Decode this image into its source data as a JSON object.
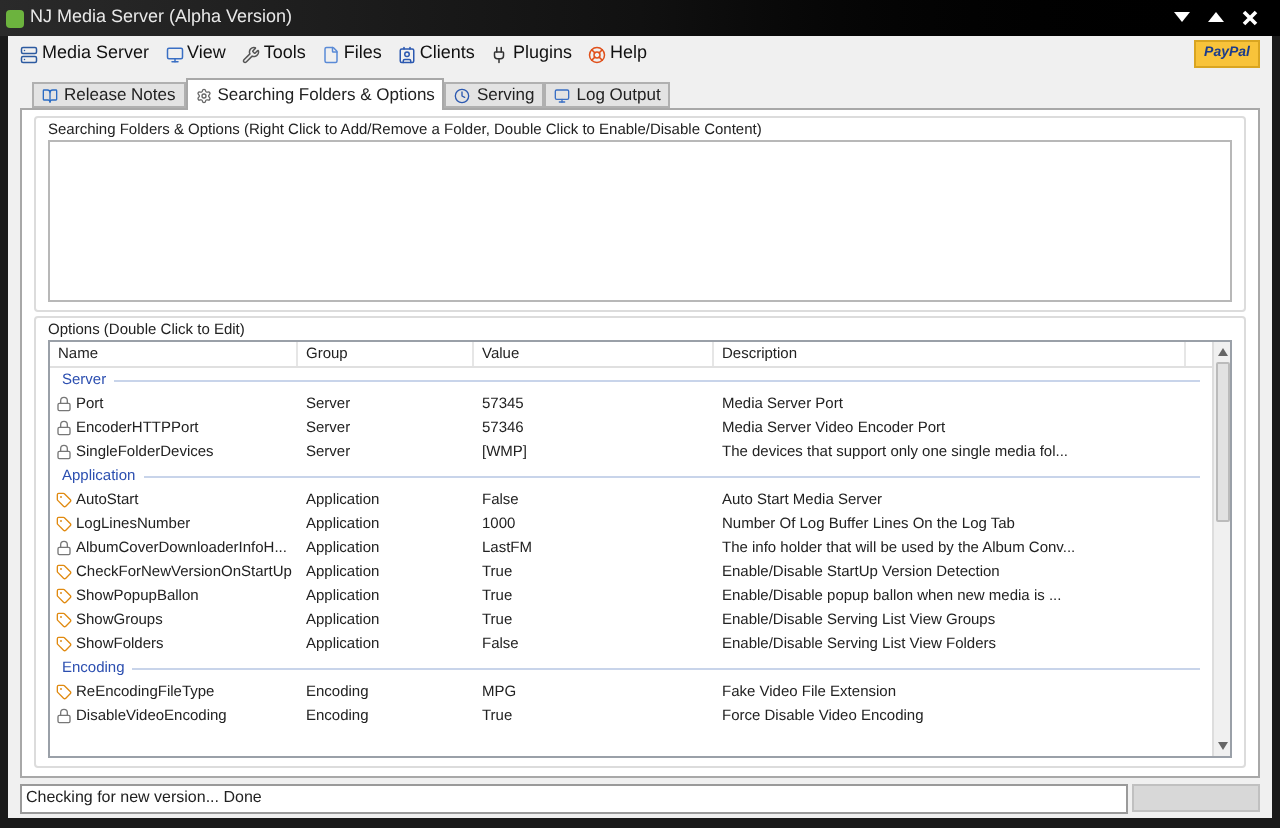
{
  "window": {
    "title": "NJ Media Server (Alpha Version)"
  },
  "menu": [
    {
      "label": "Media Server",
      "kind": "server"
    },
    {
      "label": "View",
      "kind": "monitor"
    },
    {
      "label": "Tools",
      "kind": "tools"
    },
    {
      "label": "Files",
      "kind": "file"
    },
    {
      "label": "Clients",
      "kind": "clients"
    },
    {
      "label": "Plugins",
      "kind": "plugin"
    },
    {
      "label": "Help",
      "kind": "help"
    }
  ],
  "donate_button": {
    "label": "PayPal"
  },
  "tabs": [
    {
      "label": "Release Notes",
      "kind": "book",
      "selected": false
    },
    {
      "label": "Searching Folders & Options",
      "kind": "gear",
      "selected": true
    },
    {
      "label": "Serving",
      "kind": "clock",
      "selected": false
    },
    {
      "label": "Log Output",
      "kind": "monitor",
      "selected": false
    }
  ],
  "folders_group": {
    "title": "Searching Folders & Options (Right Click to Add/Remove a Folder, Double Click to Enable/Disable Content)"
  },
  "options_group": {
    "title": "Options (Double Click to Edit)"
  },
  "table": {
    "columns": [
      "Name",
      "Group",
      "Value",
      "Description"
    ],
    "groups": [
      {
        "title": "Server",
        "rows": [
          {
            "kind": "locked",
            "cells": [
              "Port",
              "Server",
              "57345",
              "Media Server Port"
            ]
          },
          {
            "kind": "locked",
            "cells": [
              "EncoderHTTPPort",
              "Server",
              "57346",
              "Media Server Video Encoder Port"
            ]
          },
          {
            "kind": "locked",
            "cells": [
              "SingleFolderDevices",
              "Server",
              "[WMP]",
              "The devices that support only one single media fol..."
            ]
          }
        ]
      },
      {
        "title": "Application",
        "rows": [
          {
            "kind": "editable",
            "cells": [
              "AutoStart",
              "Application",
              "False",
              "Auto Start Media Server"
            ]
          },
          {
            "kind": "editable",
            "cells": [
              "LogLinesNumber",
              "Application",
              "1000",
              "Number Of Log Buffer Lines On the Log Tab"
            ]
          },
          {
            "kind": "locked",
            "cells": [
              "AlbumCoverDownloaderInfoH...",
              "Application",
              "LastFM",
              "The info holder that will be used by the Album Conv..."
            ]
          },
          {
            "kind": "editable",
            "cells": [
              "CheckForNewVersionOnStartUp",
              "Application",
              "True",
              "Enable/Disable StartUp Version Detection"
            ]
          },
          {
            "kind": "editable",
            "cells": [
              "ShowPopupBallon",
              "Application",
              "True",
              "Enable/Disable popup ballon when new media is ..."
            ]
          },
          {
            "kind": "editable",
            "cells": [
              "ShowGroups",
              "Application",
              "True",
              "Enable/Disable Serving List View Groups"
            ]
          },
          {
            "kind": "editable",
            "cells": [
              "ShowFolders",
              "Application",
              "False",
              "Enable/Disable Serving List View Folders"
            ]
          }
        ]
      },
      {
        "title": "Encoding",
        "rows": [
          {
            "kind": "editable",
            "cells": [
              "ReEncodingFileType",
              "Encoding",
              "MPG",
              "Fake Video File Extension"
            ]
          },
          {
            "kind": "locked",
            "cells": [
              "DisableVideoEncoding",
              "Encoding",
              "True",
              "Force Disable Video Encoding"
            ]
          }
        ]
      }
    ]
  },
  "status_bar": {
    "text": "Checking for new version... Done",
    "progress": {
      "level": 0
    }
  }
}
